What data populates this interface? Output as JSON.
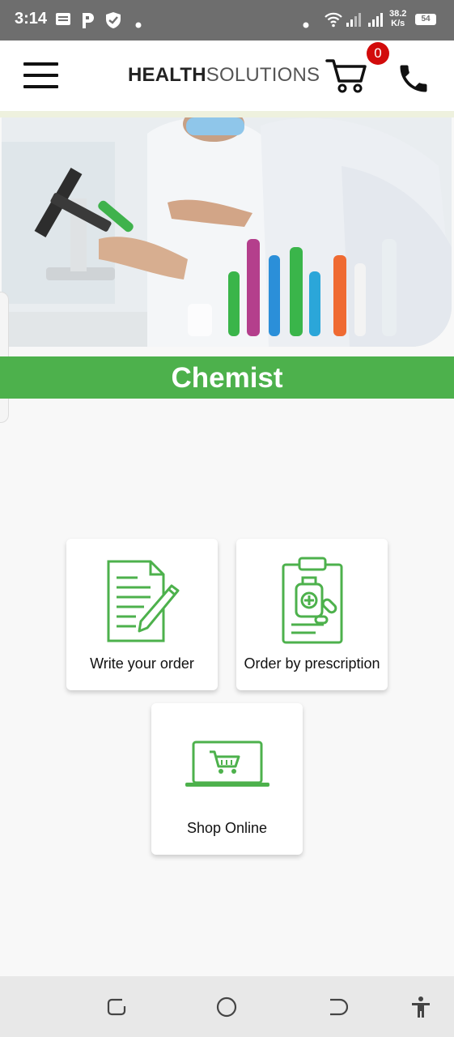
{
  "status_bar": {
    "time": "3:14",
    "icons": [
      "message-icon",
      "p-app-icon",
      "shield-icon",
      "dot-icon",
      "wifi-icon",
      "signal-icon",
      "signal-icon"
    ],
    "net_speed_value": "38.2",
    "net_speed_unit": "K/s",
    "battery": "54"
  },
  "header": {
    "logo_bold": "HEALTH",
    "logo_light": "SOLUTIONS",
    "cart_count": "0",
    "icons": [
      "menu-icon",
      "cart-icon",
      "phone-icon"
    ]
  },
  "hero": {
    "image": "laboratory-scientists-photo"
  },
  "page": {
    "title": "Chemist"
  },
  "cards": [
    {
      "label": "Write your order",
      "icon": "document-pencil-icon"
    },
    {
      "label": "Order by prescription",
      "icon": "prescription-clipboard-icon"
    },
    {
      "label": "Shop Online",
      "icon": "laptop-cart-icon"
    }
  ],
  "nav_bar": {
    "icons": [
      "recent-apps-icon",
      "home-icon",
      "back-icon",
      "accessibility-icon"
    ]
  },
  "colors": {
    "accent_green": "#4db14c",
    "badge_red": "#d20b0b",
    "status_bar": "#6e6e6e"
  }
}
